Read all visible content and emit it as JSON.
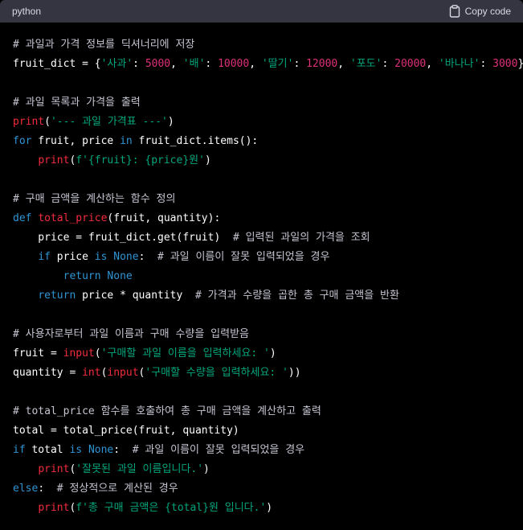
{
  "header": {
    "language": "python",
    "copy_label": "Copy code"
  },
  "colors": {
    "background": "#000000",
    "header_bg": "#343541",
    "comment": "#c5c5d2",
    "keyword": "#2e95d3",
    "function": "#f22c3d",
    "string": "#00a67d",
    "number": "#df3079"
  },
  "code": {
    "lines": [
      [
        [
          "cmt",
          "# 과일과 가격 정보를 딕셔너리에 저장"
        ]
      ],
      [
        [
          "plain",
          "fruit_dict = {"
        ],
        [
          "str",
          "'사과'"
        ],
        [
          "plain",
          ": "
        ],
        [
          "num",
          "5000"
        ],
        [
          "plain",
          ", "
        ],
        [
          "str",
          "'배'"
        ],
        [
          "plain",
          ": "
        ],
        [
          "num",
          "10000"
        ],
        [
          "plain",
          ", "
        ],
        [
          "str",
          "'딸기'"
        ],
        [
          "plain",
          ": "
        ],
        [
          "num",
          "12000"
        ],
        [
          "plain",
          ", "
        ],
        [
          "str",
          "'포도'"
        ],
        [
          "plain",
          ": "
        ],
        [
          "num",
          "20000"
        ],
        [
          "plain",
          ", "
        ],
        [
          "str",
          "'바나나'"
        ],
        [
          "plain",
          ": "
        ],
        [
          "num",
          "3000"
        ],
        [
          "plain",
          "}"
        ]
      ],
      [],
      [
        [
          "cmt",
          "# 과일 목록과 가격을 출력"
        ]
      ],
      [
        [
          "fn",
          "print"
        ],
        [
          "plain",
          "("
        ],
        [
          "str",
          "'--- 과일 가격표 ---'"
        ],
        [
          "plain",
          ")"
        ]
      ],
      [
        [
          "kw",
          "for"
        ],
        [
          "plain",
          " fruit, price "
        ],
        [
          "kw",
          "in"
        ],
        [
          "plain",
          " fruit_dict.items():"
        ]
      ],
      [
        [
          "plain",
          "    "
        ],
        [
          "fn",
          "print"
        ],
        [
          "plain",
          "("
        ],
        [
          "str",
          "f'{fruit}: {price}원'"
        ],
        [
          "plain",
          ")"
        ]
      ],
      [],
      [
        [
          "cmt",
          "# 구매 금액을 계산하는 함수 정의"
        ]
      ],
      [
        [
          "kw",
          "def"
        ],
        [
          "plain",
          " "
        ],
        [
          "fn",
          "total_price"
        ],
        [
          "plain",
          "(fruit, quantity):"
        ]
      ],
      [
        [
          "plain",
          "    price = fruit_dict.get(fruit)  "
        ],
        [
          "cmt",
          "# 입력된 과일의 가격을 조회"
        ]
      ],
      [
        [
          "plain",
          "    "
        ],
        [
          "kw",
          "if"
        ],
        [
          "plain",
          " price "
        ],
        [
          "kw",
          "is"
        ],
        [
          "plain",
          " "
        ],
        [
          "kw",
          "None"
        ],
        [
          "plain",
          ":  "
        ],
        [
          "cmt",
          "# 과일 이름이 잘못 입력되었을 경우"
        ]
      ],
      [
        [
          "plain",
          "        "
        ],
        [
          "kw",
          "return"
        ],
        [
          "plain",
          " "
        ],
        [
          "kw",
          "None"
        ]
      ],
      [
        [
          "plain",
          "    "
        ],
        [
          "kw",
          "return"
        ],
        [
          "plain",
          " price * quantity  "
        ],
        [
          "cmt",
          "# 가격과 수량을 곱한 총 구매 금액을 반환"
        ]
      ],
      [],
      [
        [
          "cmt",
          "# 사용자로부터 과일 이름과 구매 수량을 입력받음"
        ]
      ],
      [
        [
          "plain",
          "fruit = "
        ],
        [
          "fn",
          "input"
        ],
        [
          "plain",
          "("
        ],
        [
          "str",
          "'구매할 과일 이름을 입력하세요: '"
        ],
        [
          "plain",
          ")"
        ]
      ],
      [
        [
          "plain",
          "quantity = "
        ],
        [
          "fn",
          "int"
        ],
        [
          "plain",
          "("
        ],
        [
          "fn",
          "input"
        ],
        [
          "plain",
          "("
        ],
        [
          "str",
          "'구매할 수량을 입력하세요: '"
        ],
        [
          "plain",
          "))"
        ]
      ],
      [],
      [
        [
          "cmt",
          "# total_price 함수를 호출하여 총 구매 금액을 계산하고 출력"
        ]
      ],
      [
        [
          "plain",
          "total = total_price(fruit, quantity)"
        ]
      ],
      [
        [
          "kw",
          "if"
        ],
        [
          "plain",
          " total "
        ],
        [
          "kw",
          "is"
        ],
        [
          "plain",
          " "
        ],
        [
          "kw",
          "None"
        ],
        [
          "plain",
          ":  "
        ],
        [
          "cmt",
          "# 과일 이름이 잘못 입력되었을 경우"
        ]
      ],
      [
        [
          "plain",
          "    "
        ],
        [
          "fn",
          "print"
        ],
        [
          "plain",
          "("
        ],
        [
          "str",
          "'잘못된 과일 이름입니다.'"
        ],
        [
          "plain",
          ")"
        ]
      ],
      [
        [
          "kw",
          "else"
        ],
        [
          "plain",
          ":  "
        ],
        [
          "cmt",
          "# 정상적으로 계산된 경우"
        ]
      ],
      [
        [
          "plain",
          "    "
        ],
        [
          "fn",
          "print"
        ],
        [
          "plain",
          "("
        ],
        [
          "str",
          "f'총 구매 금액은 {total}원 입니다.'"
        ],
        [
          "plain",
          ")"
        ]
      ]
    ]
  }
}
